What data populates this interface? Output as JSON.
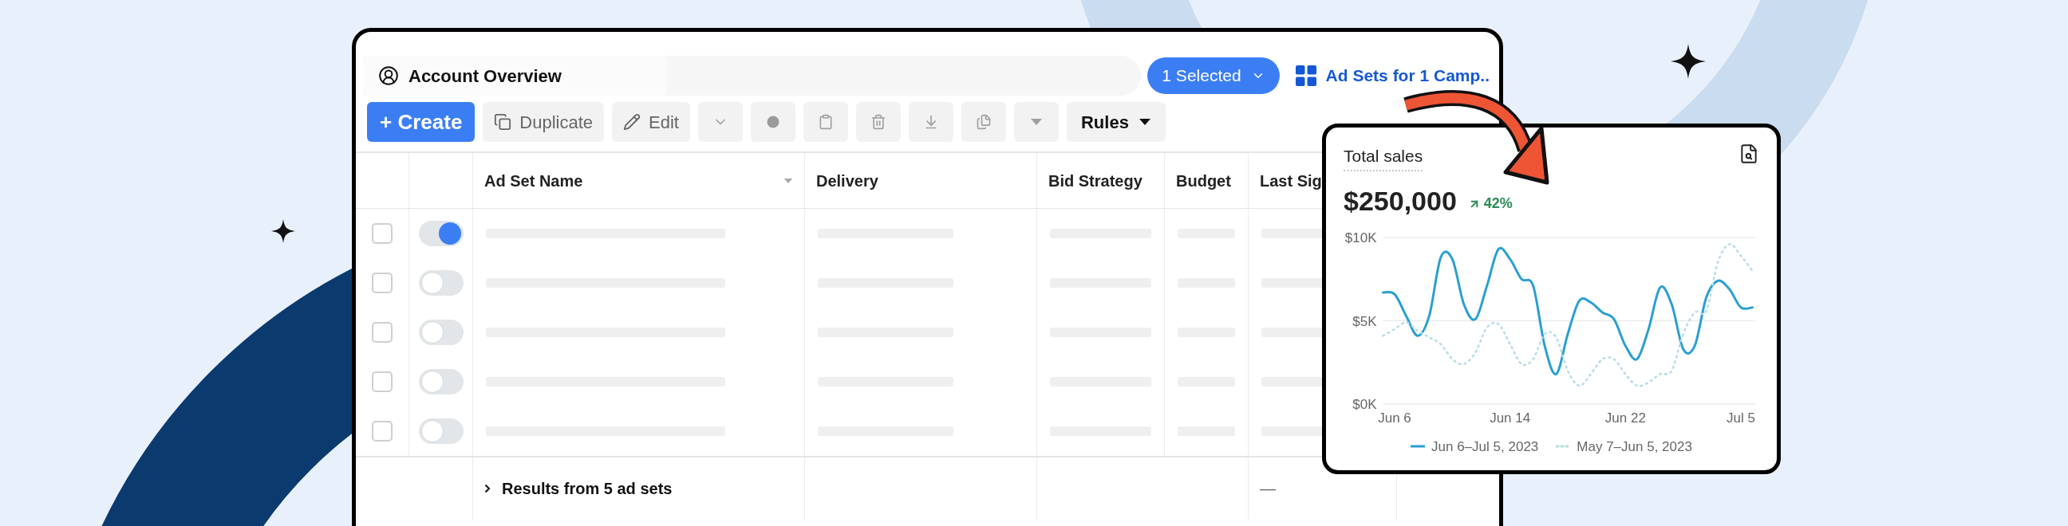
{
  "header": {
    "account_tab": "Account Overview",
    "selection": "1 Selected",
    "breadcrumb": "Ad Sets for 1 Camp.."
  },
  "toolbar": [
    {
      "kind": "primary",
      "label": "+ Create"
    },
    {
      "kind": "text",
      "label": "Duplicate"
    },
    {
      "kind": "text",
      "label": "Edit"
    },
    {
      "kind": "icon"
    },
    {
      "kind": "icon"
    },
    {
      "kind": "icon"
    },
    {
      "kind": "icon"
    },
    {
      "kind": "icon"
    },
    {
      "kind": "icon"
    },
    {
      "kind": "icon"
    },
    {
      "kind": "menu",
      "label": "Rules"
    }
  ],
  "table": {
    "columns": [
      {
        "label": "Ad Set Name",
        "sortable": true
      },
      {
        "label": "Delivery"
      },
      {
        "label": "Bid Strategy"
      },
      {
        "label": "Budget"
      },
      {
        "label": "Last Sig"
      }
    ],
    "rows": [
      {
        "checked": false,
        "on": true
      },
      {
        "checked": false,
        "on": false
      },
      {
        "checked": false,
        "on": false
      },
      {
        "checked": false,
        "on": false
      },
      {
        "checked": false,
        "on": false
      }
    ],
    "footer": {
      "summary": "Results from 5 ad sets",
      "last_column": "—"
    }
  },
  "sales_card": {
    "title": "Total sales",
    "total": "$250,000",
    "change": "42%",
    "chart_data": {
      "type": "line",
      "categories": [
        null,
        "Jun 6",
        null,
        null,
        null,
        null,
        null,
        null,
        null,
        null,
        null,
        "Jun 14",
        null,
        null,
        null,
        null,
        null,
        null,
        null,
        null,
        null,
        "Jun 22",
        null,
        null,
        null,
        null,
        null,
        null,
        null,
        null,
        null,
        "Jul 5",
        null
      ],
      "ylim": [
        0,
        10
      ],
      "legend": true,
      "yticks": [
        {
          "value": 0,
          "label": "$0K"
        },
        {
          "value": 5,
          "label": "$5K"
        },
        {
          "value": 10,
          "label": "$10K"
        }
      ],
      "series": [
        {
          "name": "Jun 6–Jul 5, 2023",
          "color": "#2a9fd0",
          "line_style": "solid",
          "values": [
            6.7,
            6.6,
            5.3,
            4.1,
            5.3,
            8.8,
            8.7,
            6.0,
            5.1,
            7.1,
            9.3,
            8.7,
            7.5,
            7.1,
            3.5,
            1.8,
            4.2,
            6.2,
            6.1,
            5.5,
            5.1,
            3.5,
            2.7,
            4.5,
            7.0,
            6.0,
            3.3,
            3.5,
            6.4,
            7.4,
            6.9,
            5.8,
            5.8
          ]
        },
        {
          "name": "May 7–Jun 5, 2023",
          "color": "#b7dde6",
          "line_style": "dotted",
          "values": [
            4.1,
            4.5,
            4.9,
            4.4,
            4.0,
            3.6,
            2.7,
            2.4,
            3.1,
            4.6,
            4.8,
            3.6,
            2.4,
            2.7,
            4.2,
            4.0,
            2.0,
            1.1,
            1.8,
            2.7,
            2.7,
            1.8,
            1.1,
            1.3,
            1.8,
            2.0,
            4.2,
            5.5,
            5.6,
            8.5,
            9.6,
            8.9,
            8.0
          ]
        }
      ]
    }
  }
}
